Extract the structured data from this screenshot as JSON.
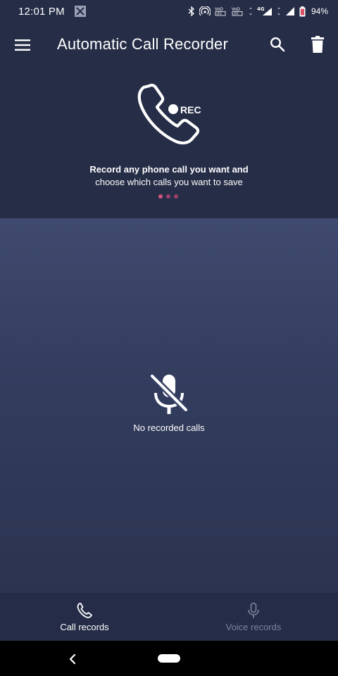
{
  "status_bar": {
    "time": "12:01 PM",
    "notification_icon": "x-icon",
    "volte_label": "VoLTE",
    "network_label": "4G",
    "battery_percent": "94%"
  },
  "app_bar": {
    "title": "Automatic Call Recorder",
    "menu_icon": "hamburger-menu-icon",
    "search_icon": "search-icon",
    "delete_icon": "trash-icon"
  },
  "banner": {
    "icon": "phone-rec-icon",
    "rec_label": "REC",
    "line1": "Record any phone call you want and",
    "line2": "choose which calls you want to save",
    "page_indicator": {
      "count": 3,
      "active": 0
    }
  },
  "empty_state": {
    "icon": "mic-off-icon",
    "text": "No recorded calls"
  },
  "bottom_nav": {
    "items": [
      {
        "label": "Call records",
        "icon": "phone-icon",
        "active": true
      },
      {
        "label": "Voice records",
        "icon": "microphone-icon",
        "active": false
      }
    ]
  },
  "colors": {
    "app_bar": "#262d47",
    "content_top": "#3f4a6e",
    "content_bottom": "#2b3350",
    "accent_dots": "#d4557f",
    "inactive_tab": "#7d849c"
  }
}
